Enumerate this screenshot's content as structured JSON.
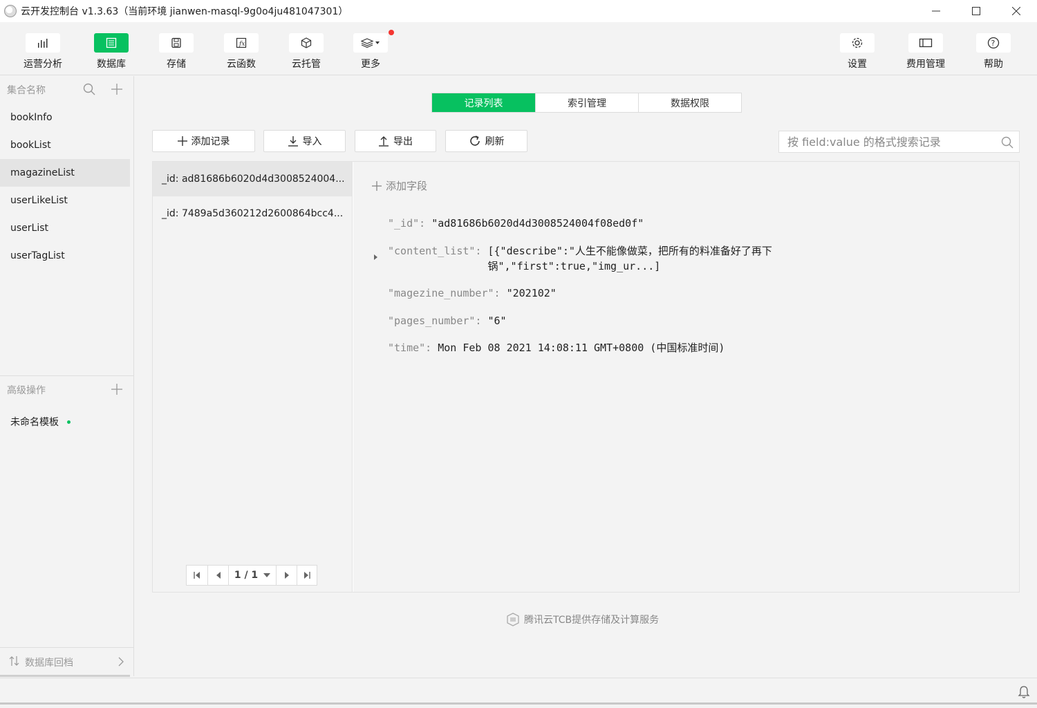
{
  "window": {
    "title": "云开发控制台 v1.3.63（当前环境 jianwen-masql-9g0o4ju481047301）"
  },
  "toolbar": {
    "left": [
      {
        "label": "运营分析",
        "icon": "bar-chart-icon"
      },
      {
        "label": "数据库",
        "icon": "database-icon",
        "active": true
      },
      {
        "label": "存储",
        "icon": "storage-icon"
      },
      {
        "label": "云函数",
        "icon": "function-icon"
      },
      {
        "label": "云托管",
        "icon": "cube-icon"
      },
      {
        "label": "更多",
        "icon": "layers-icon",
        "badge": true
      }
    ],
    "right": [
      {
        "label": "设置",
        "icon": "gear-icon"
      },
      {
        "label": "费用管理",
        "icon": "wallet-icon"
      },
      {
        "label": "帮助",
        "icon": "help-icon"
      }
    ]
  },
  "sidebar": {
    "collections_header": "集合名称",
    "collections": [
      "bookInfo",
      "bookList",
      "magazineList",
      "userLikeList",
      "userList",
      "userTagList"
    ],
    "selected_collection": "magazineList",
    "advanced_header": "高级操作",
    "template": "未命名模板",
    "rollback": "数据库回档"
  },
  "tabs": [
    "记录列表",
    "索引管理",
    "数据权限"
  ],
  "active_tab": "记录列表",
  "actions": {
    "add_record": "添加记录",
    "import": "导入",
    "export": "导出",
    "refresh": "刷新"
  },
  "search": {
    "placeholder": "按 field:value 的格式搜索记录"
  },
  "records": [
    "_id: ad81686b6020d4d3008524004...",
    "_id: 7489a5d360212d2600864bcc4..."
  ],
  "pager": {
    "page": "1 / 1"
  },
  "detail": {
    "add_field": "添加字段",
    "fields": [
      {
        "key": "\"_id\": ",
        "value": "\"ad81686b6020d4d3008524004f08ed0f\""
      },
      {
        "key": "\"content_list\": ",
        "value": "[{\"describe\":\"人生不能像做菜，把所有的料准备好了再下",
        "value2": "锅\",\"first\":true,\"img_ur...]"
      },
      {
        "key": "\"magezine_number\": ",
        "value": "\"202102\""
      },
      {
        "key": "\"pages_number\": ",
        "value": "\"6\""
      },
      {
        "key": "\"time\": ",
        "value": "Mon Feb 08 2021 14:08:11 GMT+0800 (中国标准时间)"
      }
    ]
  },
  "footer": {
    "note": "腾讯云TCB提供存储及计算服务"
  },
  "colors": {
    "accent": "#07c160",
    "badge": "#f43530"
  }
}
